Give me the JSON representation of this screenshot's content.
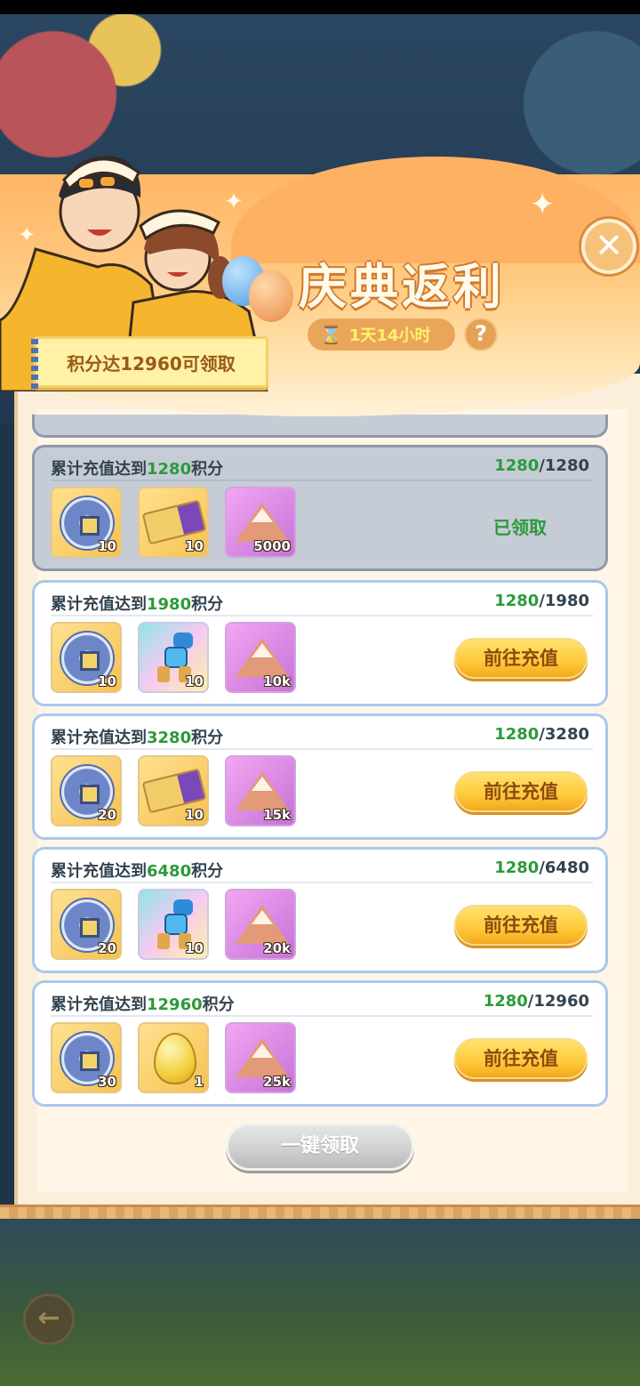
{
  "header": {
    "title": "庆典返利",
    "timer": "1天14小时",
    "help_label": "?",
    "close_label": "✕",
    "points_tag": "积分达12960可领取"
  },
  "cards": [
    {
      "prefix": "累计充值达到",
      "target": "1280",
      "suffix": "积分",
      "progress_current": "1280",
      "progress_total": "/1280",
      "status": "已领取",
      "items": [
        {
          "icon": "coin-icon",
          "qty": "10"
        },
        {
          "icon": "ticket-icon",
          "qty": "10"
        },
        {
          "icon": "sand-pile-icon",
          "qty": "5000"
        }
      ]
    },
    {
      "prefix": "累计充值达到",
      "target": "1980",
      "suffix": "积分",
      "progress_current": "1280",
      "progress_total": "/1980",
      "action": "前往充值",
      "items": [
        {
          "icon": "coin-icon",
          "qty": "10"
        },
        {
          "icon": "robot-icon",
          "qty": "10"
        },
        {
          "icon": "sand-pile-icon",
          "qty": "10k"
        }
      ]
    },
    {
      "prefix": "累计充值达到",
      "target": "3280",
      "suffix": "积分",
      "progress_current": "1280",
      "progress_total": "/3280",
      "action": "前往充值",
      "items": [
        {
          "icon": "coin-icon",
          "qty": "20"
        },
        {
          "icon": "ticket-icon",
          "qty": "10"
        },
        {
          "icon": "sand-pile-icon",
          "qty": "15k"
        }
      ]
    },
    {
      "prefix": "累计充值达到",
      "target": "6480",
      "suffix": "积分",
      "progress_current": "1280",
      "progress_total": "/6480",
      "action": "前往充值",
      "items": [
        {
          "icon": "coin-icon",
          "qty": "20"
        },
        {
          "icon": "robot-icon",
          "qty": "10"
        },
        {
          "icon": "sand-pile-icon",
          "qty": "20k"
        }
      ]
    },
    {
      "prefix": "累计充值达到",
      "target": "12960",
      "suffix": "积分",
      "progress_current": "1280",
      "progress_total": "/12960",
      "action": "前往充值",
      "items": [
        {
          "icon": "coin-icon",
          "qty": "30"
        },
        {
          "icon": "egg-icon",
          "qty": "1"
        },
        {
          "icon": "sand-pile-icon",
          "qty": "25k"
        }
      ]
    }
  ],
  "footer": {
    "claim_all": "一键领取",
    "back_icon": "back-arrow-icon"
  },
  "colors": {
    "accent_green": "#2b9b3a",
    "button_gold": "#ffc93a",
    "banner_orange": "#ffb566"
  }
}
